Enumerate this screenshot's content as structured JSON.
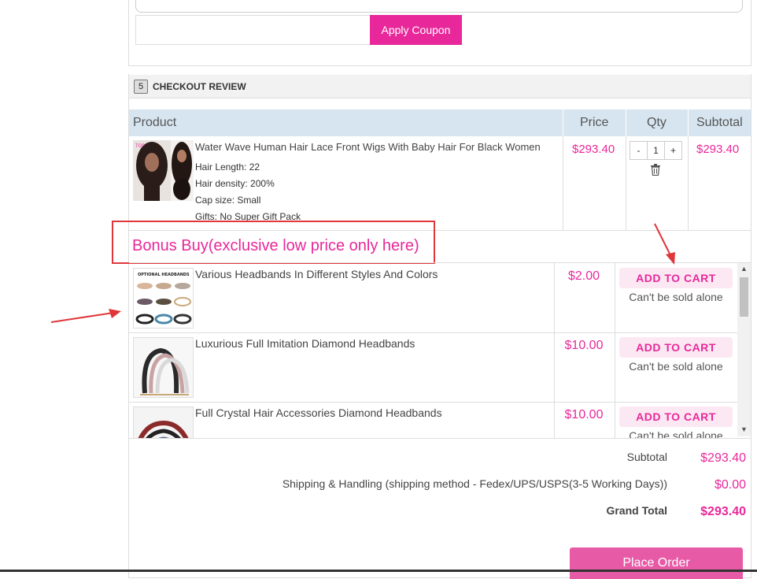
{
  "coupon": {
    "button_label": "Apply Coupon",
    "input_value": ""
  },
  "section": {
    "number": "5",
    "title": "CHECKOUT REVIEW"
  },
  "table_headers": {
    "product": "Product",
    "price": "Price",
    "qty": "Qty",
    "subtotal": "Subtotal"
  },
  "cart_item": {
    "name": "Water Wave Human Hair Lace Front Wigs With Baby Hair For Black Women",
    "options": [
      {
        "label": "Hair Length:",
        "value": "22"
      },
      {
        "label": "Hair density:",
        "value": "200%"
      },
      {
        "label": "Cap size:",
        "value": "Small"
      },
      {
        "label": "Gifts:",
        "value": "No Super Gift Pack"
      }
    ],
    "price": "$293.40",
    "qty_minus": "-",
    "qty_value": "1",
    "qty_plus": "+",
    "subtotal": "$293.40",
    "delete_icon": "trash-icon"
  },
  "bonus": {
    "title": "Bonus Buy(exclusive low price only here)",
    "items": [
      {
        "name": "Various Headbands In Different Styles And Colors",
        "price": "$2.00",
        "button": "ADD TO CART",
        "note": "Can't be sold alone"
      },
      {
        "name": "Luxurious Full Imitation Diamond Headbands",
        "price": "$10.00",
        "button": "ADD TO CART",
        "note": "Can't be sold alone"
      },
      {
        "name": "Full Crystal Hair Accessories Diamond Headbands",
        "price": "$10.00",
        "button": "ADD TO CART",
        "note": "Can't be sold alone"
      }
    ],
    "thumb_header_text": "OPTIONAL HEADBANDS"
  },
  "totals": {
    "subtotal_label": "Subtotal",
    "subtotal_value": "$293.40",
    "shipping_label": "Shipping & Handling (shipping method - Fedex/UPS/USPS(3-5 Working Days))",
    "shipping_value": "$0.00",
    "grand_label": "Grand Total",
    "grand_value": "$293.40"
  },
  "place_order": "Place Order",
  "colors": {
    "accent": "#e8289a",
    "header_bg": "#d6e5f0",
    "annotation": "#e0373b"
  }
}
